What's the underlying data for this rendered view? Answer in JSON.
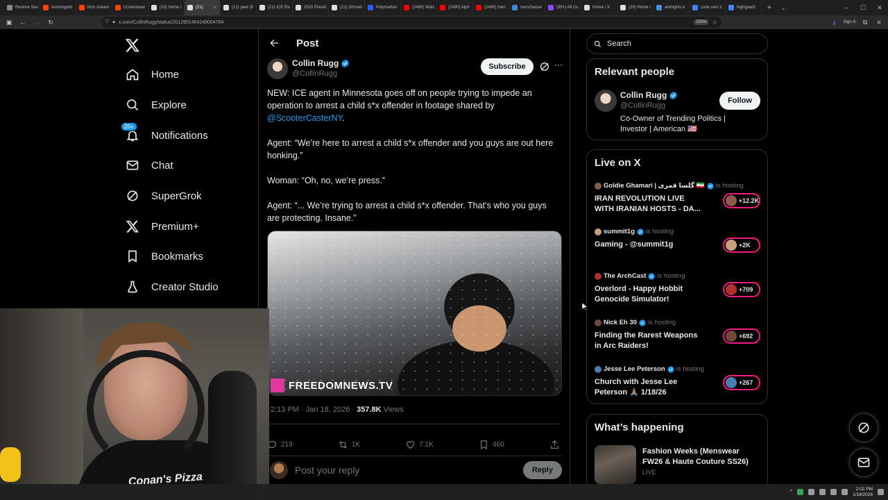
{
  "browser": {
    "tabs": [
      {
        "label": "Restore Ses",
        "color": "#888888"
      },
      {
        "label": "Asmongold",
        "color": "#ff4500"
      },
      {
        "label": "Kick stream",
        "color": "#ff4500"
      },
      {
        "label": "r/Livestrean",
        "color": "#ff4500"
      },
      {
        "label": "(19) Home /",
        "color": "#dddddd"
      },
      {
        "label": "(21)",
        "color": "#dddddd",
        "active": true
      },
      {
        "label": "(21) yeet (6",
        "color": "#dddddd"
      },
      {
        "label": "(21) ICE Ra",
        "color": "#dddddd"
      },
      {
        "label": "2015 Presid",
        "color": "#dddddd"
      },
      {
        "label": "(21) Grinnel",
        "color": "#dddddd"
      },
      {
        "label": "Polymarket",
        "color": "#2e5bff"
      },
      {
        "label": "(2490) Watc",
        "color": "#ff0000"
      },
      {
        "label": "(2490) Alph",
        "color": "#ff0000"
      },
      {
        "label": "(2490) Irani",
        "color": "#ff0000"
      },
      {
        "label": "munchause",
        "color": "#3c8cdc"
      },
      {
        "label": "(99+) All Co",
        "color": "#8a4cff"
      },
      {
        "label": "Home / X",
        "color": "#dddddd"
      },
      {
        "label": "(20) Home /",
        "color": "#dddddd"
      },
      {
        "label": "arknights e",
        "color": "#4a90e2"
      },
      {
        "label": "code vein 2",
        "color": "#4285f4"
      },
      {
        "label": "highguard",
        "color": "#4285f4"
      }
    ],
    "url": "x.com/CollinRugg/status/2012951464248004764",
    "zoom": "150%",
    "sign_in": "Sign in"
  },
  "nav": {
    "items": [
      {
        "label": "Home",
        "icon": "home-icon"
      },
      {
        "label": "Explore",
        "icon": "search-icon"
      },
      {
        "label": "Notifications",
        "icon": "bell-icon",
        "badge": "20+"
      },
      {
        "label": "Chat",
        "icon": "mail-icon"
      },
      {
        "label": "SuperGrok",
        "icon": "grok-icon"
      },
      {
        "label": "Premium+",
        "icon": "x-logo-icon"
      },
      {
        "label": "Bookmarks",
        "icon": "bookmark-icon"
      },
      {
        "label": "Creator Studio",
        "icon": "flask-icon"
      }
    ]
  },
  "post": {
    "header_title": "Post",
    "author_name": "Collin Rugg",
    "author_handle": "@CollinRugg",
    "subscribe_label": "Subscribe",
    "text_p1": "NEW: ICE agent in Minnesota goes off on people trying to impede an operation to arrest a child s*x offender in footage shared by",
    "text_mention": "@ScooterCasterNY",
    "text_p1_end": ".",
    "text_p2": "Agent: “We’re here to arrest a child s*x offender and you guys are out here honking.”",
    "text_p3": "Woman: “Oh, no, we’re press.”",
    "text_p4": "Agent: “... We’re trying to arrest a child s*x offender. That’s who you guys are protecting. Insane.”",
    "media_watermark": "FREEDOMNEWS.TV",
    "timestamp": "2:13 PM · Jan 18, 2026 · ",
    "views_count": "357.8K",
    "views_label": " Views",
    "replies": "219",
    "reposts": "1K",
    "likes": "7.1K",
    "bookmarks": "460",
    "reply_placeholder": "Post your reply",
    "reply_button": "Reply"
  },
  "right": {
    "search_placeholder": "Search",
    "relevant_title": "Relevant people",
    "person_name": "Collin Rugg",
    "person_handle": "@CollinRugg",
    "person_bio": "Co-Owner of Trending Politics | Investor | American 🇺🇸",
    "follow_label": "Follow",
    "live_title": "Live on X",
    "live": [
      {
        "host": "Goldie Ghamari | گلسا قمری 🇮🇷",
        "status": "is hosting",
        "title": "IRAN REVOLUTION LIVE WITH IRANIAN HOSTS - DA...",
        "count": "+12.2K"
      },
      {
        "host": "summit1g",
        "status": "is hosting",
        "title": "Gaming - @summit1g",
        "count": "+2K"
      },
      {
        "host": "The ArchCast",
        "status": "is hosting",
        "title": "Overlord - Happy Hobbit Genocide Simulator!",
        "count": "+709"
      },
      {
        "host": "Nick Eh 30",
        "status": "is hosting",
        "title": "Finding the Rarest Weapons in Arc Raiders!",
        "count": "+692"
      },
      {
        "host": "Jesse Lee Peterson",
        "status": "is hosting",
        "title": "Church with Jesse Lee Peterson 🙏🏽 1/18/26",
        "count": "+267"
      }
    ],
    "happening_title": "What’s happening",
    "happening_item": "Fashion Weeks (Menswear FW26 & Haute Couture SS26)",
    "happening_status": "LIVE"
  },
  "webcam": {
    "shirt_text": "Conan's Pizza"
  },
  "taskbar": {
    "time": "2:02 PM",
    "date": "1/18/2026"
  },
  "colors": {
    "accent": "#1d9bf0",
    "live_ring": "#f91880",
    "background": "#000000",
    "border": "#2f3336"
  }
}
